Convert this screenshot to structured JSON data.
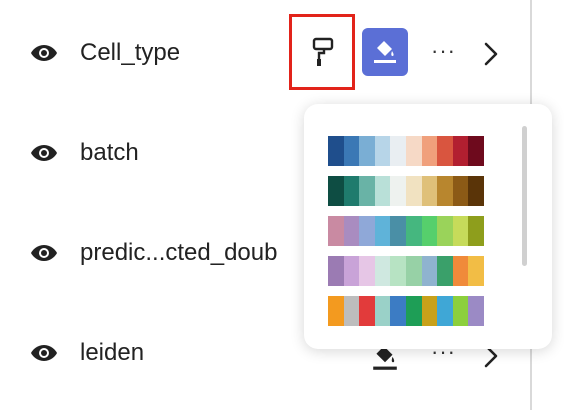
{
  "layers": [
    {
      "label": "Cell_type",
      "visible": true
    },
    {
      "label": "batch",
      "visible": true
    },
    {
      "label": "predic...cted_doub",
      "visible": true
    },
    {
      "label": "leiden",
      "visible": true
    }
  ],
  "icons": {
    "visibility": "eye-icon",
    "palette": "paint-roller-icon",
    "fill": "paint-bucket-icon",
    "more": "more-horizontal-icon",
    "expand": "chevron-right-icon"
  },
  "more_label": "···",
  "accent_color": "#5b6fd6",
  "highlight_color": "#e2231a",
  "palettes": [
    {
      "colors": [
        "#1f4e8c",
        "#3b78b5",
        "#7aaed4",
        "#b7d5e8",
        "#e9eef2",
        "#f6d9c6",
        "#f0a07c",
        "#d9553f",
        "#b21f30",
        "#6e0a1d"
      ]
    },
    {
      "colors": [
        "#0e4d43",
        "#1f7b6d",
        "#69b3a6",
        "#b9e0d8",
        "#eef2ef",
        "#f1e2c1",
        "#dfc079",
        "#b8862e",
        "#8c5a16",
        "#5a3408"
      ]
    },
    {
      "colors": [
        "#c98aa2",
        "#a98cc0",
        "#8fa8d8",
        "#5fb3d9",
        "#4a8fa6",
        "#45b77f",
        "#56cf6c",
        "#9ad35a",
        "#c6db5a",
        "#8e9e1c"
      ]
    },
    {
      "colors": [
        "#9b7bb3",
        "#c9a3d8",
        "#e6c6e6",
        "#cfe8e0",
        "#b7e3c3",
        "#97d1a6",
        "#8fb3cf",
        "#3aa06a",
        "#f08a3a",
        "#f2bd45"
      ]
    },
    {
      "colors": [
        "#f39a1f",
        "#bdbdbd",
        "#e23b3b",
        "#9ad1c8",
        "#3c7cc4",
        "#1e9e56",
        "#c8a11a",
        "#3fa7d6",
        "#8ccf3d",
        "#9b8ac5"
      ]
    }
  ]
}
